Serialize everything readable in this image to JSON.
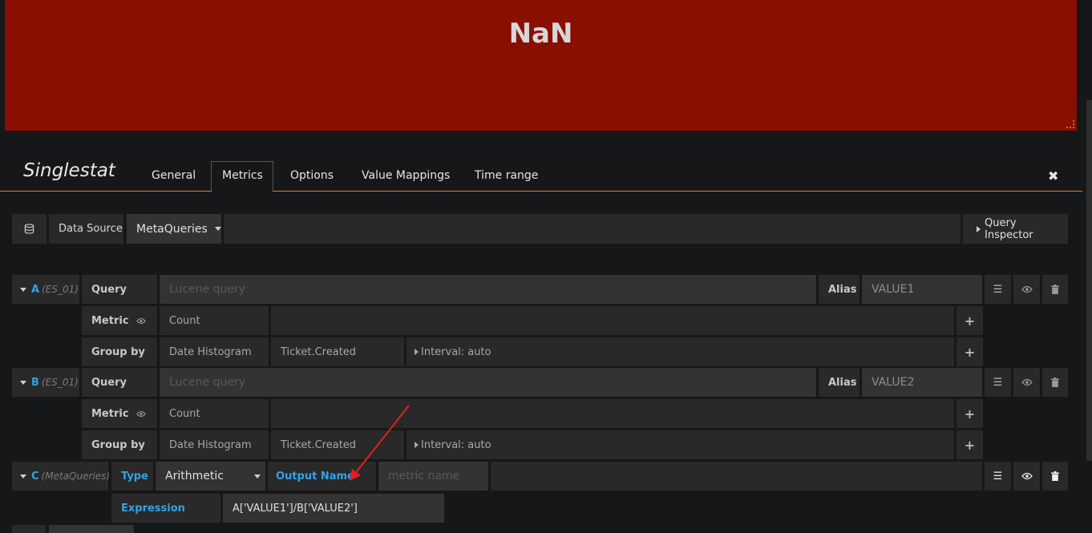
{
  "panel": {
    "stat_value": "NaN",
    "bg_color": "#890f02"
  },
  "editor": {
    "title": "Singlestat",
    "tabs": [
      "General",
      "Metrics",
      "Options",
      "Value Mappings",
      "Time range"
    ],
    "active_tab": "Metrics",
    "close_label": "✖"
  },
  "datasource": {
    "label": "Data Source",
    "value": "MetaQueries",
    "inspector_label": "Query Inspector"
  },
  "queries": {
    "a": {
      "letter": "A",
      "source": "(ES_01)",
      "query_label": "Query",
      "query_placeholder": "Lucene query",
      "alias_label": "Alias",
      "alias_value": "VALUE1",
      "metric_label": "Metric",
      "metric_value": "Count",
      "groupby_label": "Group by",
      "groupby_type": "Date Histogram",
      "groupby_field": "Ticket.Created",
      "interval": "Interval: auto"
    },
    "b": {
      "letter": "B",
      "source": "(ES_01)",
      "query_label": "Query",
      "query_placeholder": "Lucene query",
      "alias_label": "Alias",
      "alias_value": "VALUE2",
      "metric_label": "Metric",
      "metric_value": "Count",
      "groupby_label": "Group by",
      "groupby_type": "Date Histogram",
      "groupby_field": "Ticket.Created",
      "interval": "Interval: auto"
    },
    "c": {
      "letter": "C",
      "source": "(MetaQueries)",
      "type_label": "Type",
      "type_value": "Arithmetic",
      "output_label": "Output Name",
      "output_placeholder": "metric name",
      "expression_label": "Expression",
      "expression_value": "A['VALUE1']/B['VALUE2']"
    }
  },
  "colors": {
    "accent_orange": "#eb7b18",
    "link_blue": "#33a2e5",
    "annotation_red": "#e02020"
  }
}
